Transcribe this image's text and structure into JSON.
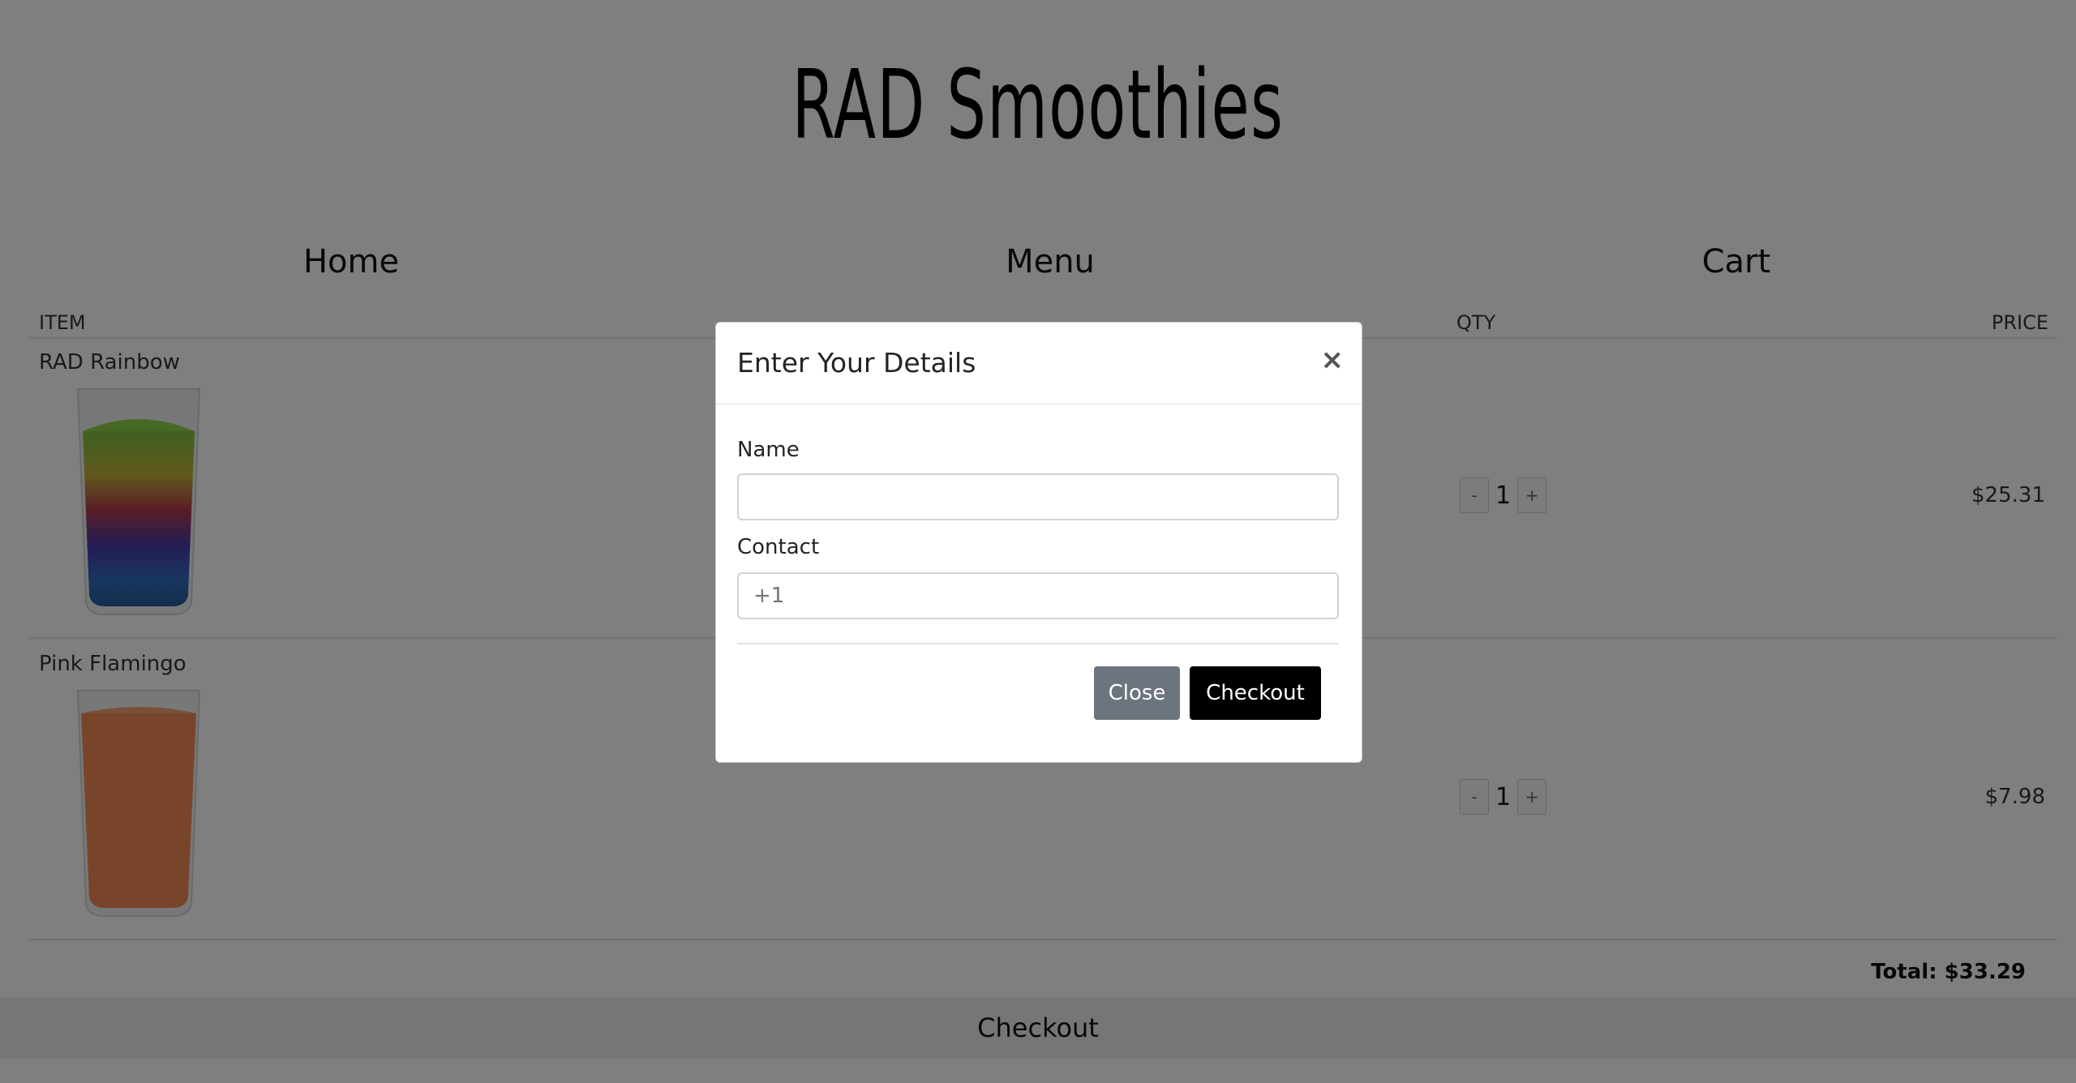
{
  "brand": {
    "title": "RAD Smoothies"
  },
  "nav": {
    "home": "Home",
    "menu": "Menu",
    "cart": "Cart"
  },
  "table": {
    "headers": {
      "item": "ITEM",
      "qty": "QTY",
      "price": "PRICE"
    },
    "rows": [
      {
        "name": "RAD Rainbow",
        "qty": "1",
        "price": "$25.31",
        "minus": "-",
        "plus": "+"
      },
      {
        "name": "Pink Flamingo",
        "qty": "1",
        "price": "$7.98",
        "minus": "-",
        "plus": "+"
      }
    ]
  },
  "total": "Total: $33.29",
  "checkout_bar": "Checkout",
  "modal": {
    "title": "Enter Your Details",
    "close_icon": "×",
    "name_label": "Name",
    "name_value": "",
    "contact_label": "Contact",
    "contact_placeholder": "+1",
    "close_button": "Close",
    "checkout_button": "Checkout"
  },
  "colors": {
    "overlay": "rgba(0,0,0,0.5)",
    "close_button": "#6c757d",
    "checkout_button": "#000000"
  }
}
